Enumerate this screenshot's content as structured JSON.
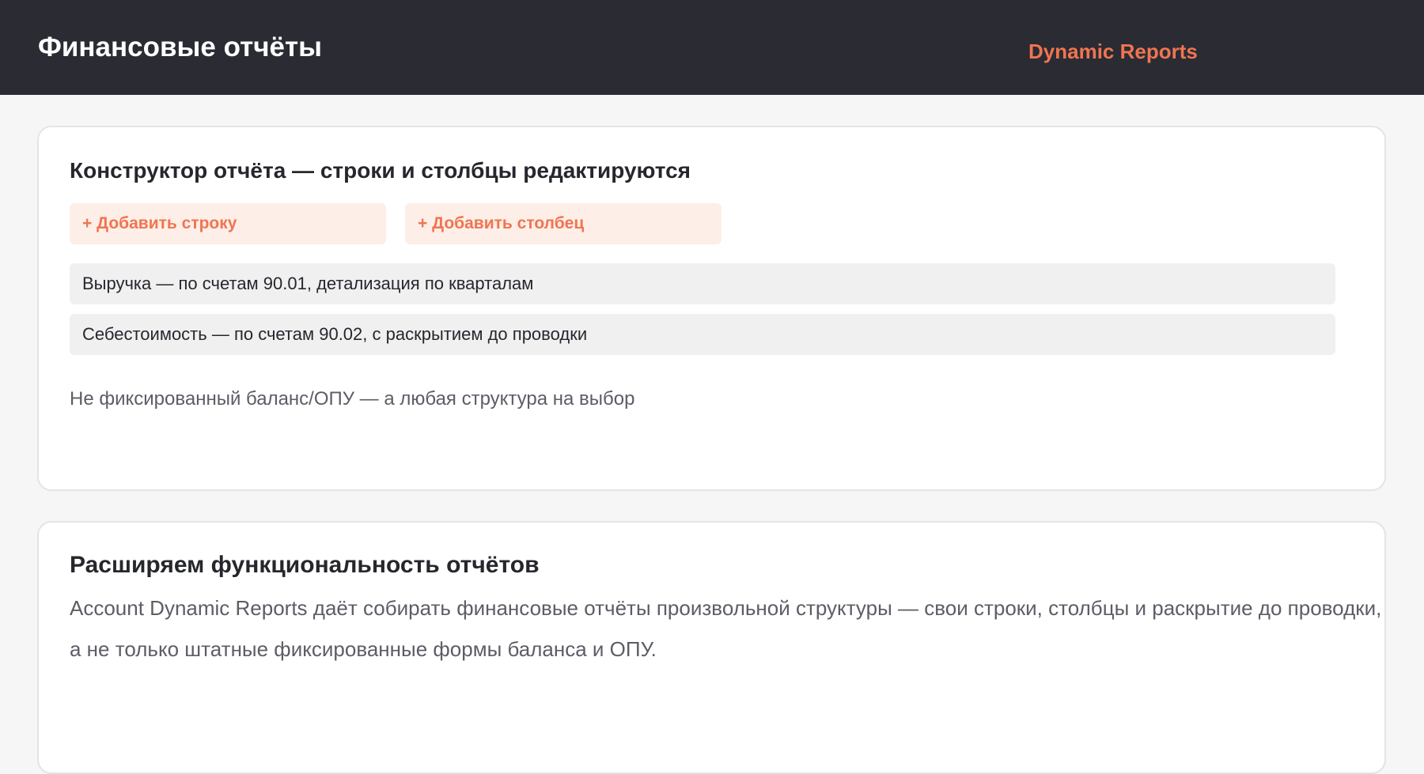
{
  "header": {
    "title": "Финансовые отчёты",
    "brand": "Dynamic Reports"
  },
  "builder": {
    "title": "Конструктор отчёта — строки и столбцы редактируются",
    "add_row_label": "+ Добавить строку",
    "add_column_label": "+ Добавить столбец",
    "rows": [
      "Выручка — по счетам 90.01, детализация по кварталам",
      "Себестоимость — по счетам 90.02, с раскрытием до проводки"
    ],
    "note": "Не фиксированный баланс/ОПУ — а любая структура на выбор"
  },
  "feature": {
    "title": "Расширяем функциональность отчётов",
    "description": "Account Dynamic Reports даёт собирать финансовые отчёты произвольной структуры — свои строки, столбцы и раскрытие до проводки, а не только штатные фиксированные формы баланса и ОПУ."
  },
  "colors": {
    "header_bg": "#2a2b33",
    "accent": "#ef7551",
    "button_bg": "#fdeee8",
    "row_bg": "#f0f0f1",
    "page_bg": "#f6f6f7"
  }
}
